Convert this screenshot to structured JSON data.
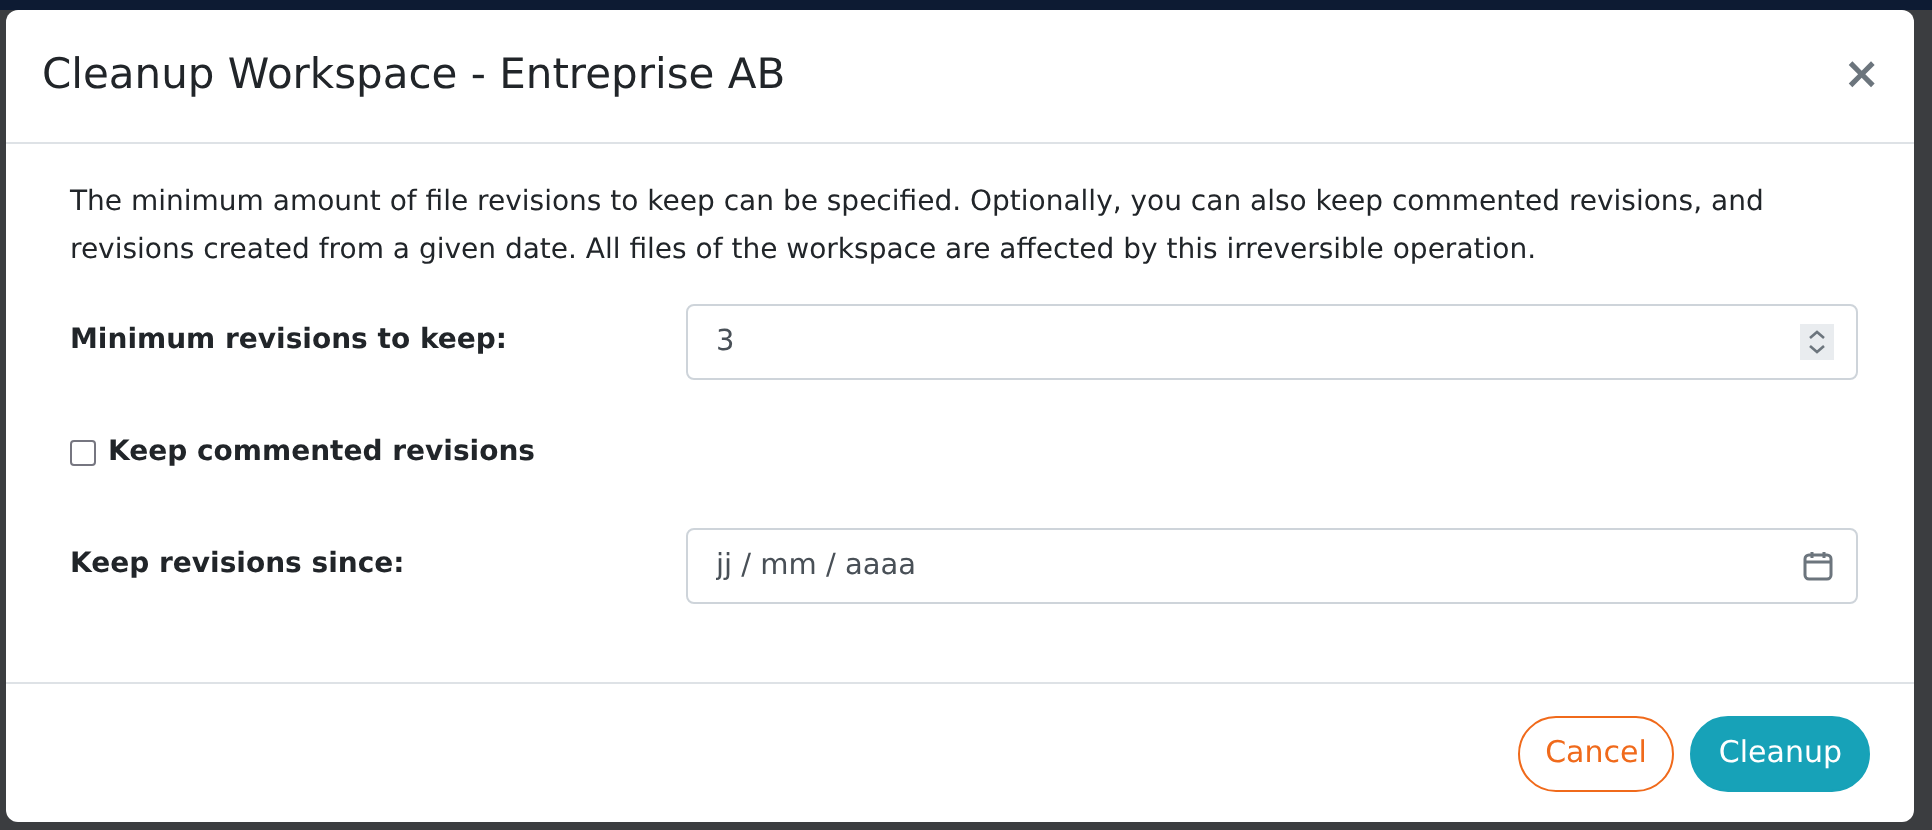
{
  "dialog": {
    "title": "Cleanup Workspace - Entreprise AB",
    "close": "×",
    "description": "The minimum amount of file revisions to keep can be specified. Optionally, you can also keep commented revisions, and revisions created from a given date. All files of the workspace are affected by this irreversible operation.",
    "fields": [
      {
        "kind": "number",
        "label": "Minimum revisions to keep:",
        "value": "3"
      },
      {
        "kind": "checkbox",
        "label": "Keep commented revisions",
        "checked": false
      },
      {
        "kind": "date",
        "label": "Keep revisions since:",
        "placeholder": "jj / mm / aaaa"
      }
    ],
    "buttons": [
      {
        "kind": "secondary",
        "label": "Cancel"
      },
      {
        "kind": "primary",
        "label": "Cleanup"
      }
    ]
  }
}
